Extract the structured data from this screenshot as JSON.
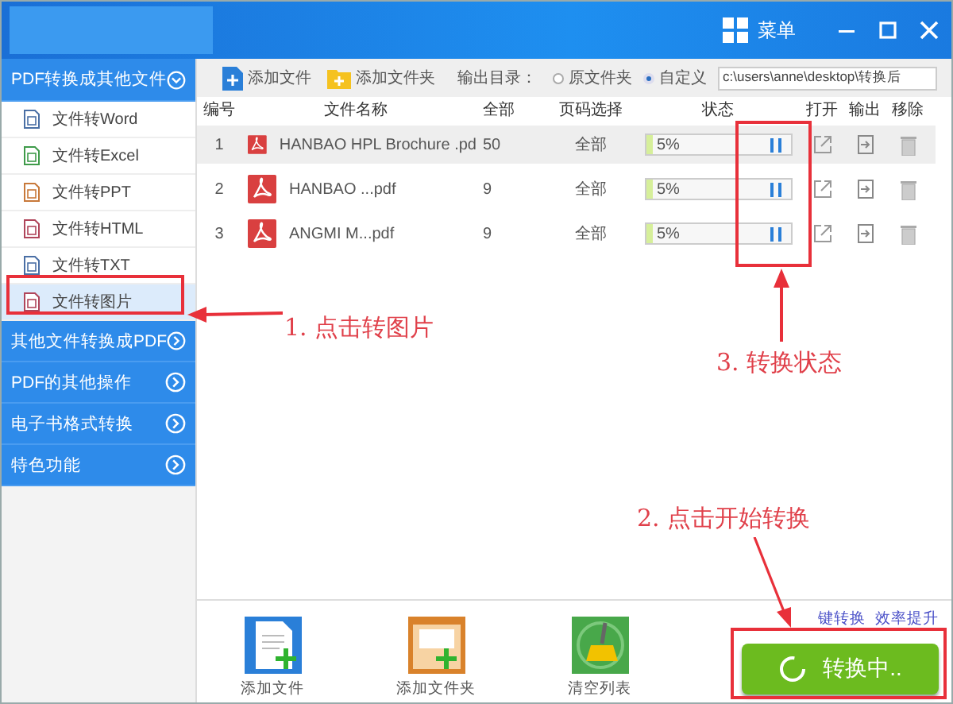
{
  "window": {
    "menu_label": "菜单"
  },
  "sidebar": {
    "sections": [
      {
        "label": "PDF转换成其他文件",
        "expanded": true,
        "items": [
          {
            "label": "文件转Word",
            "color": "#4a6fa5",
            "selected": false
          },
          {
            "label": "文件转Excel",
            "color": "#3f9b4a",
            "selected": false
          },
          {
            "label": "文件转PPT",
            "color": "#c8793a",
            "selected": false
          },
          {
            "label": "文件转HTML",
            "color": "#b0455a",
            "selected": false
          },
          {
            "label": "文件转TXT",
            "color": "#4a6fa5",
            "selected": false
          },
          {
            "label": "文件转图片",
            "color": "#b0455a",
            "selected": true
          }
        ]
      },
      {
        "label": "其他文件转换成PDF",
        "expanded": false
      },
      {
        "label": "PDF的其他操作",
        "expanded": false
      },
      {
        "label": "电子书格式转换",
        "expanded": false
      },
      {
        "label": "特色功能",
        "expanded": false
      }
    ]
  },
  "toolbar": {
    "add_file": "添加文件",
    "add_folder": "添加文件夹",
    "output_label": "输出目录：",
    "radios": [
      {
        "label": "原文件夹",
        "selected": false
      },
      {
        "label": "自定义",
        "selected": true
      }
    ],
    "path": "c:\\users\\anne\\desktop\\转换后"
  },
  "table": {
    "columns": [
      "编号",
      "文件名称",
      "全部",
      "页码选择",
      "状态",
      "打开",
      "输出",
      "移除"
    ],
    "rows": [
      {
        "index": "1",
        "name": "HANBAO HPL Brochure .pd",
        "pages": "50",
        "range": "全部",
        "level": 0.05,
        "reading": "5%",
        "selected": true
      },
      {
        "index": "2",
        "name": "HANBAO ...pdf",
        "pages": "9",
        "range": "全部",
        "level": 0.05,
        "reading": "5%",
        "selected": false
      },
      {
        "index": "3",
        "name": "ANGMI M...pdf",
        "pages": "9",
        "range": "全部",
        "level": 0.05,
        "reading": "5%",
        "selected": false
      }
    ]
  },
  "bottom": {
    "actions": [
      {
        "kind": "file",
        "label": "添加文件"
      },
      {
        "kind": "folder",
        "label": "添加文件夹"
      },
      {
        "kind": "clear",
        "label": "清空列表"
      }
    ],
    "links": [
      "键转换",
      "效率提升"
    ],
    "start_button": "转换中.."
  },
  "annotations": [
    "1. 点击转图片",
    "3. 转换状态",
    "2. 点击开始转换"
  ]
}
